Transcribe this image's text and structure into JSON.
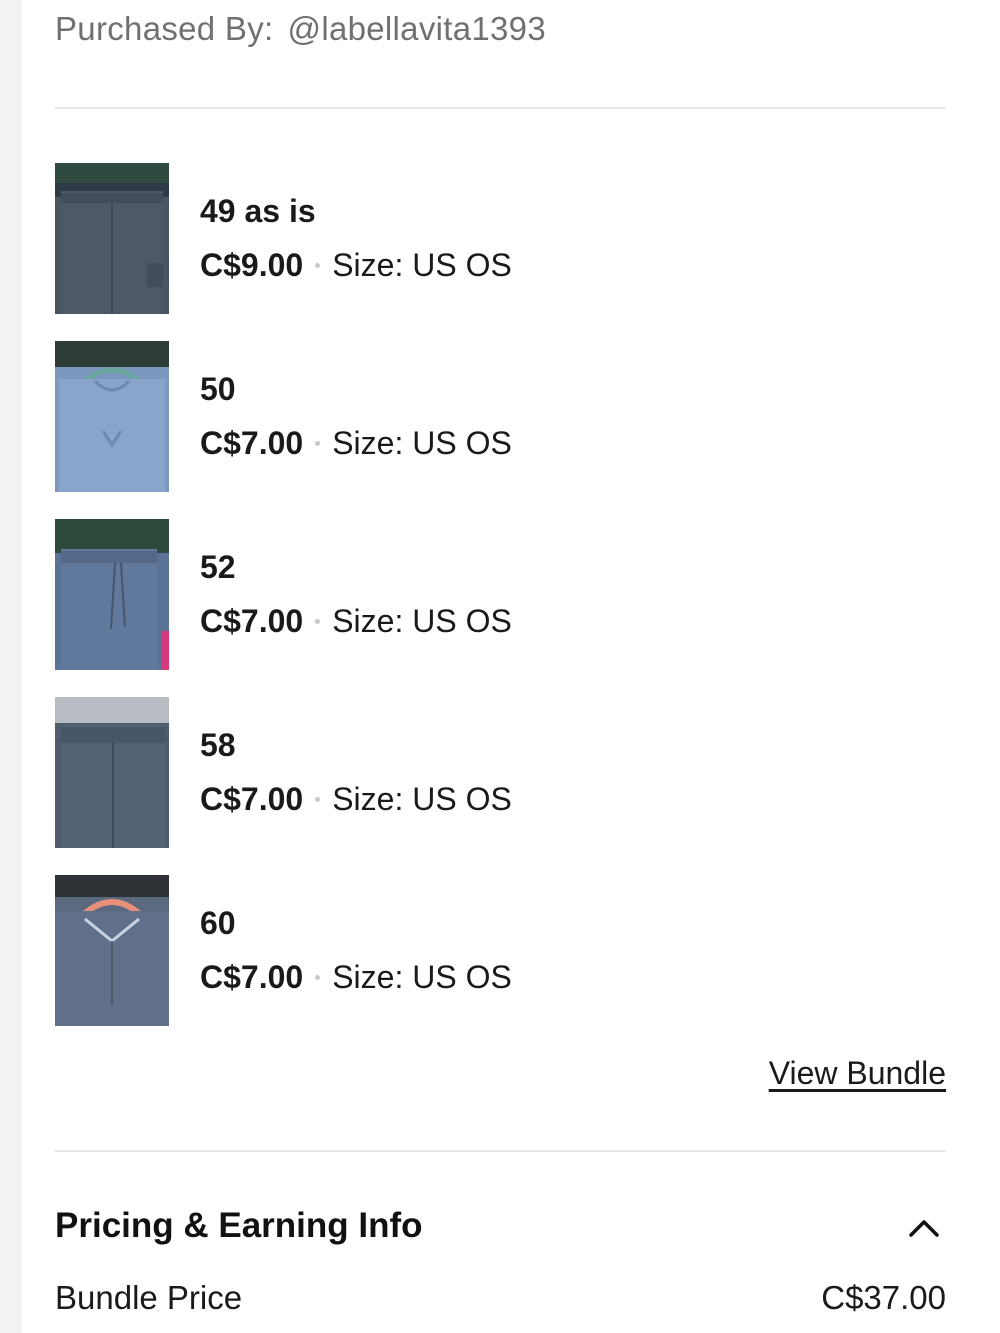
{
  "header": {
    "purchased_by_label": "Purchased By:",
    "purchased_by_user": "@labellavita1393"
  },
  "items": [
    {
      "title": "49 as is",
      "price": "C$9.00",
      "size": "Size: US OS",
      "image": "gray-sweatpants-photo"
    },
    {
      "title": "50",
      "price": "C$7.00",
      "size": "Size: US OS",
      "image": "blue-sweatshirt-photo"
    },
    {
      "title": "52",
      "price": "C$7.00",
      "size": "Size: US OS",
      "image": "blue-joggers-photo"
    },
    {
      "title": "58",
      "price": "C$7.00",
      "size": "Size: US OS",
      "image": "gray-trousers-photo"
    },
    {
      "title": "60",
      "price": "C$7.00",
      "size": "Size: US OS",
      "image": "gray-quarter-zip-photo"
    }
  ],
  "bundle": {
    "view_bundle_label": "View Bundle"
  },
  "pricing": {
    "section_title": "Pricing & Earning Info",
    "toggle_icon": "chevron-up-icon",
    "bundle_price_label": "Bundle Price",
    "bundle_price_value": "C$37.00"
  },
  "colors": {
    "text_primary": "#1a1a1a",
    "text_secondary": "#707070",
    "divider": "#e6e6e6",
    "background": "#ffffff"
  }
}
